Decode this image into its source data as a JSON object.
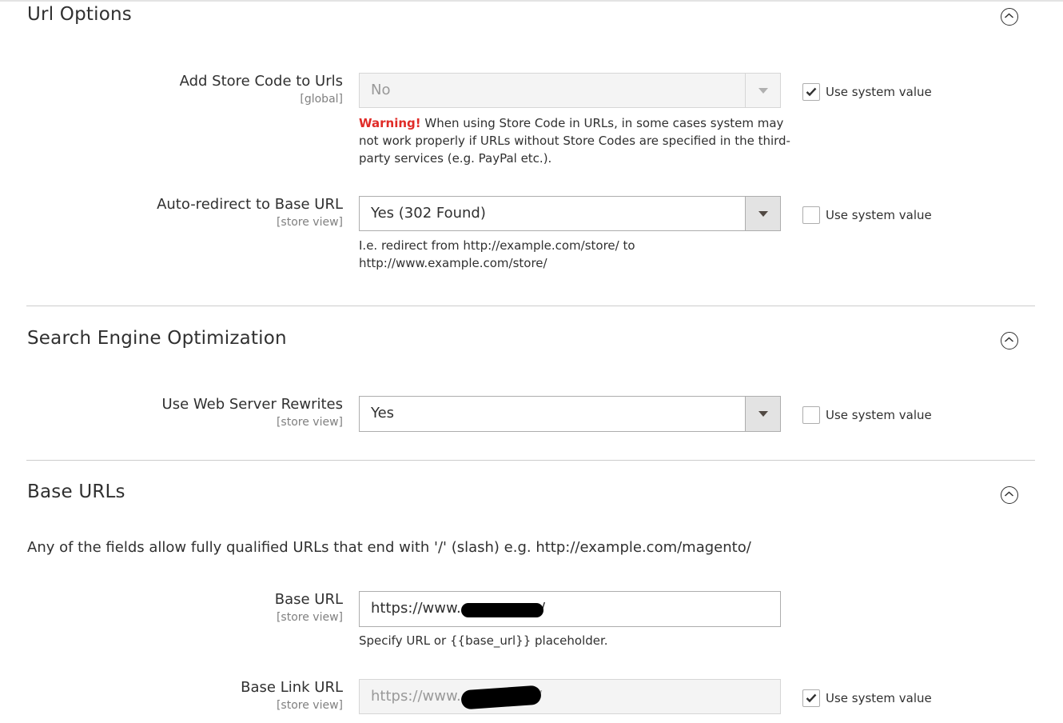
{
  "sections": {
    "url_options": {
      "title": "Url Options",
      "collapse_icon": "chevron-up-circle-icon",
      "fields": {
        "add_store_code": {
          "label": "Add Store Code to Urls",
          "scope": "[global]",
          "value": "No",
          "disabled": true,
          "warning_label": "Warning!",
          "warning_text": " When using Store Code in URLs, in some cases system may not work properly if URLs without Store Codes are specified in the third-party services (e.g. PayPal etc.).",
          "use_system_value_label": "Use system value",
          "use_system_value_checked": true
        },
        "auto_redirect": {
          "label": "Auto-redirect to Base URL",
          "scope": "[store view]",
          "value": "Yes (302 Found)",
          "disabled": false,
          "note": "I.e. redirect from http://example.com/store/ to http://www.example.com/store/",
          "use_system_value_label": "Use system value",
          "use_system_value_checked": false
        }
      }
    },
    "seo": {
      "title": "Search Engine Optimization",
      "collapse_icon": "chevron-up-circle-icon",
      "fields": {
        "web_server_rewrites": {
          "label": "Use Web Server Rewrites",
          "scope": "[store view]",
          "value": "Yes",
          "disabled": false,
          "use_system_value_label": "Use system value",
          "use_system_value_checked": false
        }
      }
    },
    "base_urls": {
      "title": "Base URLs",
      "collapse_icon": "chevron-up-circle-icon",
      "intro": "Any of the fields allow fully qualified URLs that end with '/' (slash) e.g. http://example.com/magento/",
      "fields": {
        "base_url": {
          "label": "Base URL",
          "scope": "[store view]",
          "value": "https://www.",
          "value_suffix": "/",
          "redacted": true,
          "note": "Specify URL or {{base_url}} placeholder."
        },
        "base_link_url": {
          "label": "Base Link URL",
          "scope": "[store view]",
          "value": "https://www.",
          "value_suffix": "/",
          "redacted": true,
          "disabled": true,
          "use_system_value_label": "Use system value",
          "use_system_value_checked": true
        }
      }
    }
  },
  "colors": {
    "warning": "#e02b27",
    "text": "#303030",
    "scope": "#808080",
    "divider": "#cccccc"
  }
}
